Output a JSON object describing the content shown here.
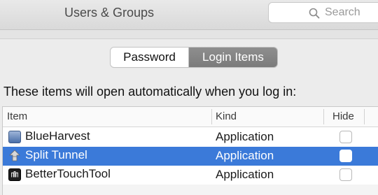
{
  "window": {
    "title": "Users & Groups"
  },
  "search": {
    "placeholder": "Search",
    "icon": "search-icon"
  },
  "tabs": [
    {
      "label": "Password",
      "selected": false
    },
    {
      "label": "Login Items",
      "selected": true
    }
  ],
  "description": "These items will open automatically when you log in:",
  "table": {
    "columns": [
      "Item",
      "Kind",
      "Hide"
    ],
    "rows": [
      {
        "name": "BlueHarvest",
        "kind": "Application",
        "hide": false,
        "selected": false,
        "icon": "blueharvest-icon"
      },
      {
        "name": "Split Tunnel",
        "kind": "Application",
        "hide": false,
        "selected": true,
        "icon": "split-tunnel-icon"
      },
      {
        "name": "BetterTouchTool",
        "kind": "Application",
        "hide": false,
        "selected": false,
        "icon": "bettertouchtool-icon"
      }
    ]
  },
  "colors": {
    "selection": "#3b7ad9",
    "selected_tab": "#838383"
  }
}
